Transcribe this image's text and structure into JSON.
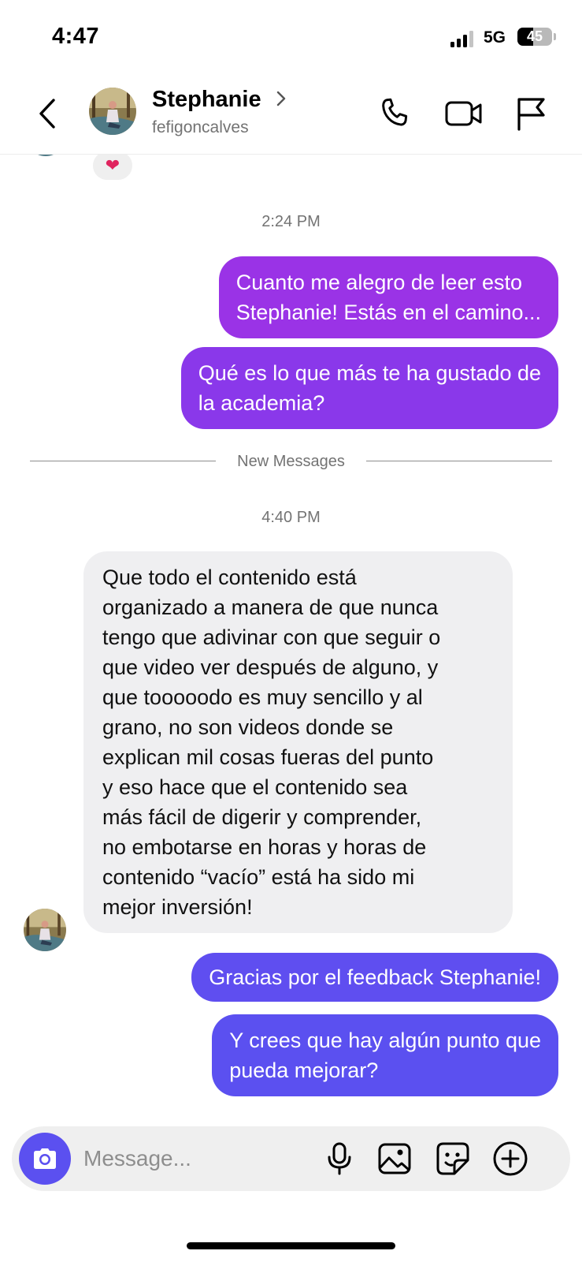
{
  "status_bar": {
    "time": "4:47",
    "network": "5G",
    "battery": "45",
    "battery_level": 0.45
  },
  "header": {
    "back_icon": "chevron-left-icon",
    "contact_name": "Stephanie",
    "contact_handle": "fefigoncalves",
    "name_chevron_icon": "chevron-right-icon",
    "actions": [
      "phone-icon",
      "video-camera-icon",
      "flag-icon"
    ]
  },
  "previous_message": {
    "reaction": "❤"
  },
  "timestamps": {
    "first": "2:24 PM",
    "second": "4:40 PM"
  },
  "divider": {
    "label": "New Messages"
  },
  "messages": {
    "out_1": {
      "lines": [
        "Cuanto me alegro de leer esto",
        "Stephanie! Estás en el camino..."
      ]
    },
    "out_2": {
      "lines": [
        "Qué es lo que más te ha gustado de",
        "la academia?"
      ]
    },
    "in_1": {
      "lines": [
        "Que todo el contenido está",
        "organizado a manera de que nunca",
        "tengo que adivinar con que seguir o",
        "que video ver después de alguno, y",
        "que tooooodo es muy sencillo y al",
        "grano, no son videos donde se",
        "explican mil cosas fueras del punto",
        "y eso hace que el contenido sea",
        "más fácil de digerir y comprender,",
        "no embotarse en horas y horas de",
        "contenido “vacío” está ha sido mi",
        "mejor inversión!"
      ]
    },
    "out_3": {
      "lines": [
        "Gracias por el feedback Stephanie!"
      ]
    },
    "out_4": {
      "lines": [
        "Y crees que hay algún punto que",
        "pueda mejorar?"
      ]
    }
  },
  "composer": {
    "placeholder": "Message...",
    "icons": [
      "camera-icon",
      "microphone-icon",
      "image-icon",
      "sticker-icon",
      "plus-circle-icon"
    ]
  },
  "colors": {
    "outgoing_early": "#9a33e6",
    "outgoing_late": "#5b50f0",
    "incoming": "#efeff1",
    "camera_button": "#5b50f0"
  }
}
